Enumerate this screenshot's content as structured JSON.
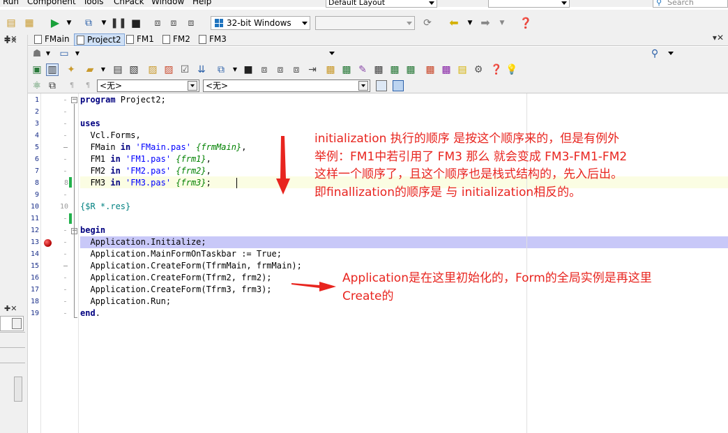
{
  "menu": [
    "Run",
    "Component",
    "Tools",
    "CnPack",
    "Window",
    "Help"
  ],
  "layout_combo": "Default Layout",
  "search_placeholder": "Search",
  "platform_combo": "32-bit Windows",
  "tabs": [
    {
      "label": "FMain",
      "active": false
    },
    {
      "label": "Project2",
      "active": true
    },
    {
      "label": "FM1",
      "active": false
    },
    {
      "label": "FM2",
      "active": false
    },
    {
      "label": "FM3",
      "active": false
    }
  ],
  "toolbar4": {
    "combo1": "<无>",
    "combo2": "<无>"
  },
  "editor": {
    "line_numbers": [
      "1",
      "2",
      "3",
      "4",
      "5",
      "6",
      "7",
      "8",
      "9",
      "10",
      "11",
      "12",
      "13",
      "14",
      "15",
      "16",
      "17",
      "18",
      "19"
    ],
    "gutter_marks": {
      "line8": "8",
      "line10": "10"
    },
    "lines": [
      {
        "kw": "program",
        "rest": " Project2;"
      },
      {
        "text": ""
      },
      {
        "kw": "uses"
      },
      {
        "text": "  Vcl.Forms,"
      },
      {
        "pre": "  FMain ",
        "kw2": "in",
        "str": " 'FMain.pas'",
        "cmt": " {frmMain}",
        "post": ","
      },
      {
        "pre": "  FM1 ",
        "kw2": "in",
        "str": " 'FM1.pas'",
        "cmt": " {frm1}",
        "post": ","
      },
      {
        "pre": "  FM2 ",
        "kw2": "in",
        "str": " 'FM2.pas'",
        "cmt": " {frm2}",
        "post": ","
      },
      {
        "pre": "  FM3 ",
        "kw2": "in",
        "str": " 'FM3.pas'",
        "cmt": " {frm3}",
        "post": ";"
      },
      {
        "text": ""
      },
      {
        "dir": "{$R *.res}"
      },
      {
        "text": ""
      },
      {
        "kw": "begin"
      },
      {
        "text": "  Application.Initialize;"
      },
      {
        "text": "  Application.MainFormOnTaskbar := True;"
      },
      {
        "text": "  Application.CreateForm(TfrmMain, frmMain);"
      },
      {
        "text": "  Application.CreateForm(Tfrm2, frm2);"
      },
      {
        "text": "  Application.CreateForm(Tfrm3, frm3);"
      },
      {
        "text": "  Application.Run;"
      },
      {
        "kw": "end",
        "rest": "."
      }
    ]
  },
  "annotations": {
    "note1": [
      "initialization 执行的顺序 是按这个顺序来的，但是有例外",
      "举例：FM1中若引用了 FM3 那么 就会变成 FM3-FM1-FM2",
      "这样一个顺序了，且这个顺序也是栈式结构的，先入后出。",
      "即finallization的顺序是 与 initialization相反的。"
    ],
    "note2": [
      "Application是在这里初始化的，Form的全局实例是再这里",
      "Create的"
    ],
    "color": "#e8251f"
  }
}
